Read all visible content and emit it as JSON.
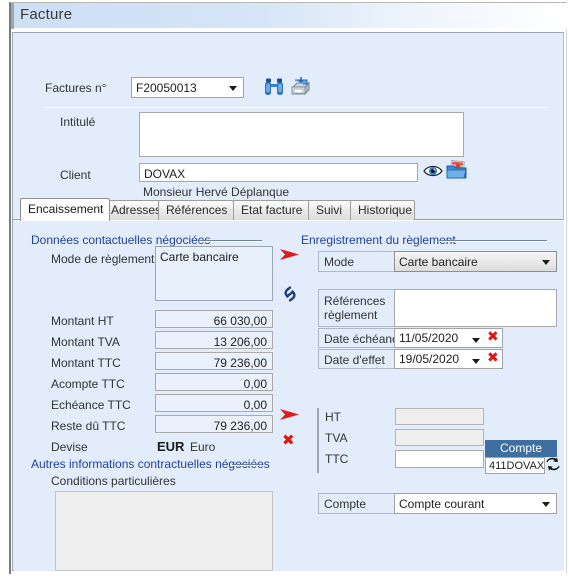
{
  "window": {
    "title": "Facture"
  },
  "header": {
    "facture_label": "Factures n°",
    "facture_value": "F20050013",
    "search_icon": "binoculars-icon",
    "print_icon": "printer-icon",
    "intitule_label": "Intitulé",
    "intitule_value": "",
    "client_label": "Client",
    "client_value": "DOVAX",
    "client_contact": "Monsieur Hervé Déplanque",
    "view_icon": "eye-icon",
    "folder_icon": "folder-icon"
  },
  "tabs": [
    {
      "label": "Encaissement",
      "active": true
    },
    {
      "label": "Adresses",
      "active": false
    },
    {
      "label": "Références",
      "active": false
    },
    {
      "label": "Etat facture",
      "active": false
    },
    {
      "label": "Suivi",
      "active": false
    },
    {
      "label": "Historique",
      "active": false
    }
  ],
  "left_panel": {
    "group_title": "Données contactuelles négociées",
    "mode_label": "Mode de règlement",
    "mode_value": "Carte bancaire",
    "rows": [
      {
        "label": "Montant HT",
        "value": "66 030,00"
      },
      {
        "label": "Montant TVA",
        "value": "13 206,00"
      },
      {
        "label": "Montant TTC",
        "value": "79 236,00"
      },
      {
        "label": "Acompte TTC",
        "value": "0,00"
      },
      {
        "label": "Echéance TTC",
        "value": "0,00"
      },
      {
        "label": "Reste dû TTC",
        "value": "79 236,00"
      }
    ],
    "devise_label": "Devise",
    "devise_code": "EUR",
    "devise_name": "Euro",
    "other_group_title": "Autres informations contractuelles négociées",
    "conditions_label": "Conditions particulières",
    "conditions_value": ""
  },
  "right_panel": {
    "group_title": "Enregistrement du règlement",
    "mode_label": "Mode",
    "mode_value": "Carte bancaire",
    "refs_label_line1": "Références",
    "refs_label_line2": "règlement",
    "refs_value": "",
    "date_echeance_label": "Date échéance",
    "date_echeance_value": "11/05/2020",
    "date_effet_label": "Date d'effet",
    "date_effet_value": "19/05/2020",
    "amount_rows": [
      {
        "label": "HT",
        "value": "",
        "readonly": true
      },
      {
        "label": "TVA",
        "value": "",
        "readonly": true
      },
      {
        "label": "TTC",
        "value": "",
        "readonly": false
      }
    ],
    "compte_badge": "Compte",
    "compte_account": "411DOVAX",
    "refresh_icon": "refresh-icon",
    "compte_label": "Compte",
    "compte_value": "Compte courant"
  },
  "icons": {
    "arrow_red": "red-arrow-icon",
    "link": "link-icon",
    "x_red": "red-x-icon"
  },
  "colors": {
    "panel_bg": "#e3ecfb",
    "group_title": "#21409a",
    "accent_red": "#e11414",
    "badge_blue": "#3f6fa0"
  }
}
